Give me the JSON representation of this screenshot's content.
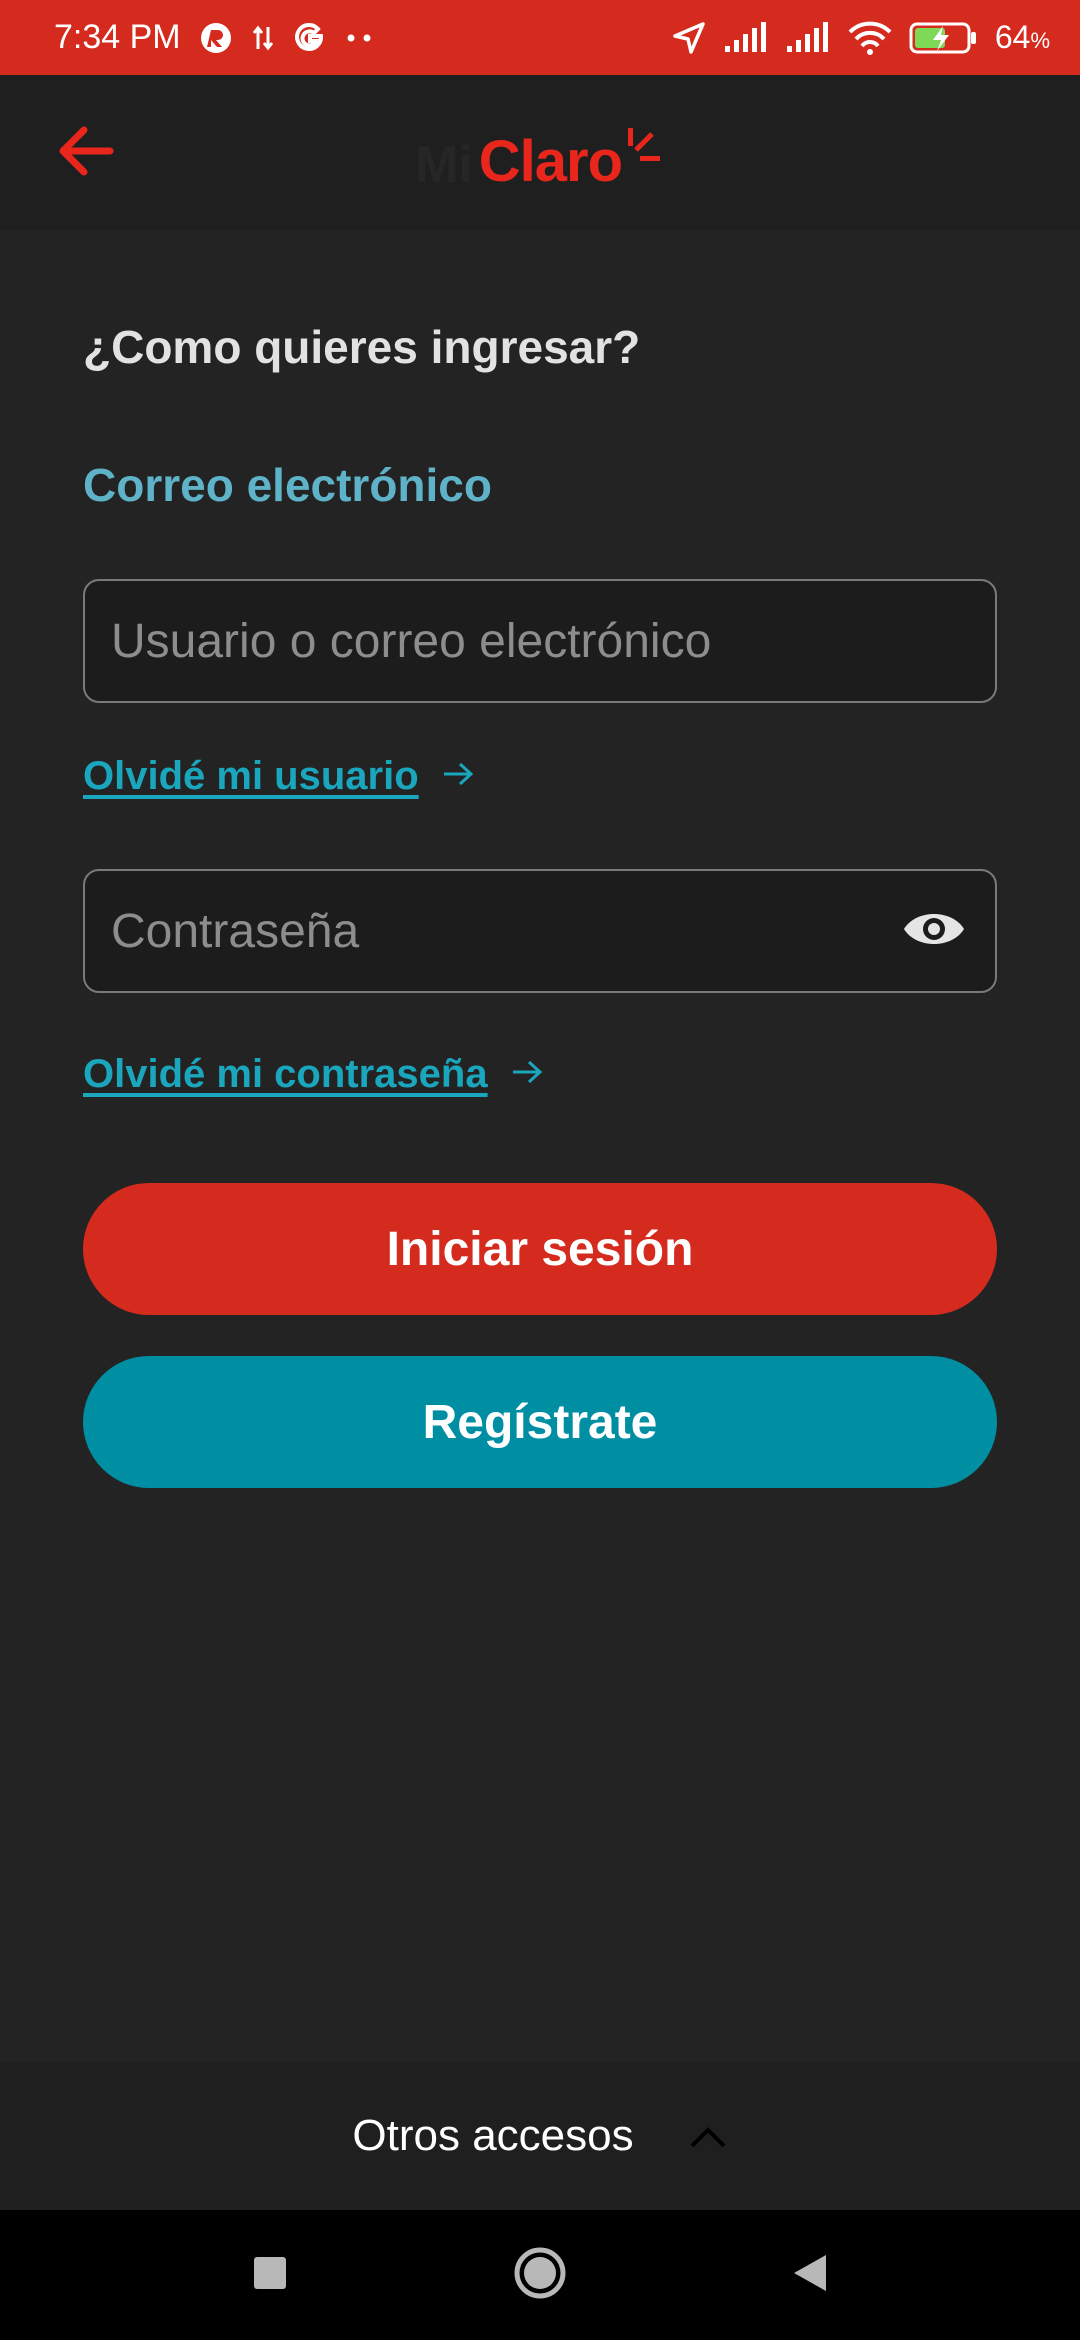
{
  "status_bar": {
    "time": "7:34 PM",
    "battery_percent": "64",
    "battery_unit": "%",
    "icons": [
      "r-badge-icon",
      "data-transfer-icon",
      "google-icon",
      "more-dots-icon",
      "location-arrow-icon",
      "signal-icon",
      "signal-icon",
      "wifi-icon",
      "battery-charging-icon"
    ]
  },
  "header": {
    "logo_mi": "Mi",
    "logo_brand": "Claro",
    "back_icon": "arrow-left-icon"
  },
  "main": {
    "question": "¿Como quieres ingresar?",
    "section_label": "Correo electrónico",
    "username_placeholder": "Usuario o correo electrónico",
    "password_placeholder": "Contraseña",
    "forgot_user": "Olvidé mi usuario",
    "forgot_password": "Olvidé mi contraseña",
    "login_button": "Iniciar sesión",
    "register_button": "Regístrate"
  },
  "footer": {
    "other_access": "Otros accesos"
  },
  "colors": {
    "brand_red": "#d52b1e",
    "teal": "#008ea3",
    "link": "#1aa6bd",
    "section_label": "#5fb3c9",
    "background": "#232323"
  }
}
